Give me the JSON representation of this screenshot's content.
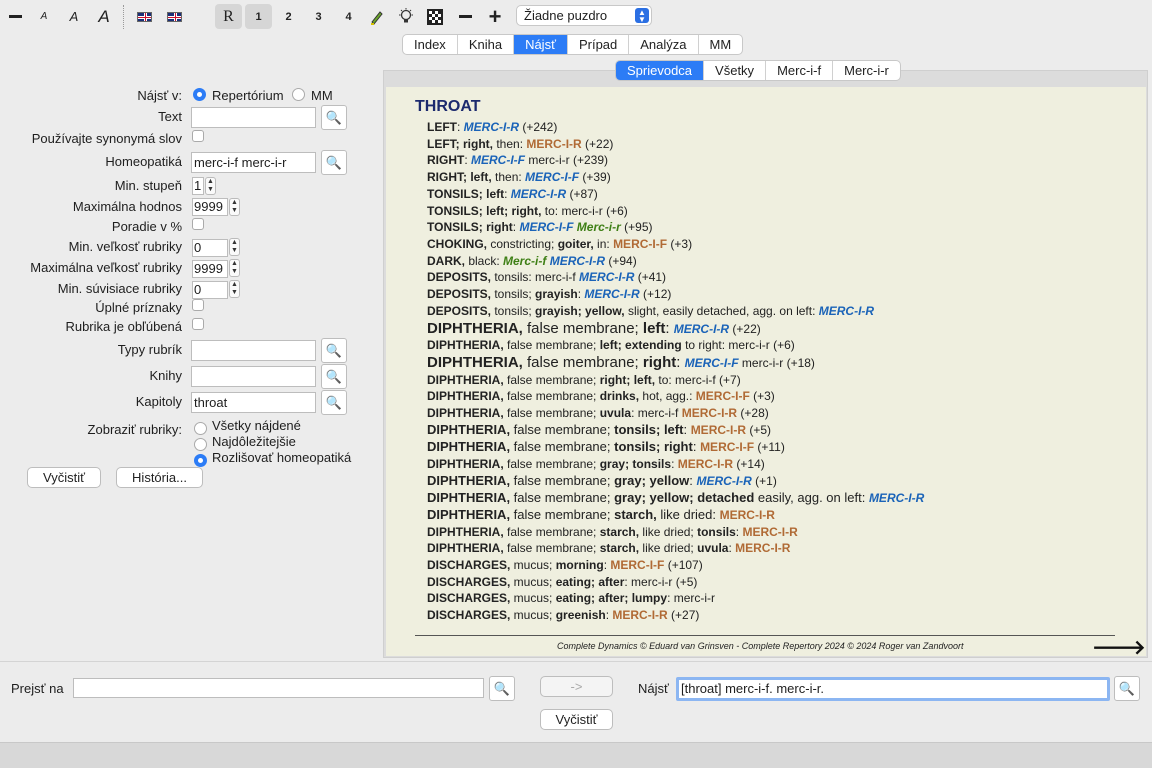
{
  "toolbar": {
    "select_value": "Žiadne puzdro",
    "level_buttons": [
      "R",
      "1",
      "2",
      "3",
      "4"
    ]
  },
  "main_tabs": [
    "Index",
    "Kniha",
    "Nájsť",
    "Prípad",
    "Analýza",
    "MM"
  ],
  "sub_tabs": [
    "Sprievodca",
    "Všetky",
    "Merc-i-f",
    "Merc-i-r"
  ],
  "form": {
    "find_in_label": "Nájsť v:",
    "find_in_options": [
      "Repertórium",
      "MM"
    ],
    "text_label": "Text",
    "text_value": "",
    "synonyms_label": "Používajte synonymá slov",
    "remedy_label": "Homeopatiká",
    "remedy_value": "merc-i-f merc-i-r",
    "min_degree_label": "Min. stupeň",
    "min_degree_value": "1",
    "max_value_label": "Maximálna hodnos",
    "max_value_value": "9999",
    "order_pct_label": "Poradie v %",
    "min_rubric_label": "Min. veľkosť rubriky",
    "min_rubric_value": "0",
    "max_rubric_label": "Maximálna veľkosť rubriky",
    "max_rubric_value": "9999",
    "min_related_label": "Min. súvisiace rubriky",
    "min_related_value": "0",
    "full_symptoms_label": "Úplné príznaky",
    "favorite_label": "Rubrika je obľúbená",
    "rubric_types_label": "Typy rubrík",
    "rubric_types_value": "",
    "books_label": "Knihy",
    "books_value": "",
    "chapters_label": "Kapitoly",
    "chapters_value": "throat",
    "show_label": "Zobraziť rubriky:",
    "show_options": [
      "Všetky nájdené",
      "Najdôležitejšie",
      "Rozlišovať homeopatiká"
    ],
    "clear_button": "Vyčistiť",
    "history_button": "História..."
  },
  "result": {
    "chapter": "THROAT",
    "rubrics": [
      [
        [
          "h",
          "LEFT"
        ],
        [
          "p",
          ": "
        ],
        [
          "b",
          "MERC-I-R"
        ],
        [
          "p",
          " (+242)"
        ]
      ],
      [
        [
          "h",
          "LEFT; right,"
        ],
        [
          "c",
          " then: "
        ],
        [
          "o",
          "MERC-I-R"
        ],
        [
          "p",
          " (+22)"
        ]
      ],
      [
        [
          "h",
          "RIGHT"
        ],
        [
          "p",
          ": "
        ],
        [
          "b",
          "MERC-I-F"
        ],
        [
          "p",
          " merc-i-r (+239)"
        ]
      ],
      [
        [
          "h",
          "RIGHT; left,"
        ],
        [
          "c",
          " then: "
        ],
        [
          "b",
          "MERC-I-F"
        ],
        [
          "p",
          " (+39)"
        ]
      ],
      [
        [
          "h",
          "TONSILS; left"
        ],
        [
          "p",
          ": "
        ],
        [
          "b",
          "MERC-I-R"
        ],
        [
          "p",
          " (+87)"
        ]
      ],
      [
        [
          "h",
          "TONSILS; left; right,"
        ],
        [
          "c",
          " to: merc-i-r (+6)"
        ]
      ],
      [
        [
          "h",
          "TONSILS; right"
        ],
        [
          "p",
          ": "
        ],
        [
          "b",
          "MERC-I-F"
        ],
        [
          "p",
          " "
        ],
        [
          "g",
          "Merc-i-r"
        ],
        [
          "p",
          " (+95)"
        ]
      ],
      [
        [
          "h",
          "CHOKING,"
        ],
        [
          "c",
          " constricting; "
        ],
        [
          "h",
          "goiter,"
        ],
        [
          "c",
          " in: "
        ],
        [
          "o",
          "MERC-I-F"
        ],
        [
          "p",
          " (+3)"
        ]
      ],
      [
        [
          "h",
          "DARK,"
        ],
        [
          "c",
          " black: "
        ],
        [
          "g",
          "Merc-i-f"
        ],
        [
          "p",
          " "
        ],
        [
          "b",
          "MERC-I-R"
        ],
        [
          "p",
          " (+94)"
        ]
      ],
      [
        [
          "h",
          "DEPOSITS,"
        ],
        [
          "c",
          " tonsils: merc-i-f "
        ],
        [
          "b",
          "MERC-I-R"
        ],
        [
          "p",
          " (+41)"
        ]
      ],
      [
        [
          "h",
          "DEPOSITS,"
        ],
        [
          "c",
          " tonsils; "
        ],
        [
          "h",
          "grayish"
        ],
        [
          "p",
          ": "
        ],
        [
          "b",
          "MERC-I-R"
        ],
        [
          "p",
          " (+12)"
        ]
      ],
      [
        [
          "h",
          "DEPOSITS,"
        ],
        [
          "c",
          " tonsils; "
        ],
        [
          "h",
          "grayish; yellow,"
        ],
        [
          "c",
          " slight, easily detached, agg. on left: "
        ],
        [
          "b",
          "MERC-I-R"
        ]
      ],
      [
        [
          "big",
          ""
        ],
        [
          "h",
          "DIPHTHERIA,"
        ],
        [
          "c",
          " false membrane; "
        ],
        [
          "h",
          "left"
        ],
        [
          "p",
          ": "
        ],
        [
          "bs",
          "MERC-I-R"
        ],
        [
          "ps",
          " (+22)"
        ]
      ],
      [
        [
          "h",
          "DIPHTHERIA,"
        ],
        [
          "c",
          " false membrane; "
        ],
        [
          "h",
          "left; extending"
        ],
        [
          "c",
          " to right: merc-i-r (+6)"
        ]
      ],
      [
        [
          "big",
          ""
        ],
        [
          "h",
          "DIPHTHERIA,"
        ],
        [
          "c",
          " false membrane; "
        ],
        [
          "h",
          "right"
        ],
        [
          "p",
          ": "
        ],
        [
          "bs",
          "MERC-I-F"
        ],
        [
          "ps",
          " merc-i-r (+18)"
        ]
      ],
      [
        [
          "h",
          "DIPHTHERIA,"
        ],
        [
          "c",
          " false membrane; "
        ],
        [
          "h",
          "right; left,"
        ],
        [
          "c",
          " to: merc-i-f (+7)"
        ]
      ],
      [
        [
          "h",
          "DIPHTHERIA,"
        ],
        [
          "c",
          " false membrane; "
        ],
        [
          "h",
          "drinks,"
        ],
        [
          "c",
          " hot, agg.: "
        ],
        [
          "o",
          "MERC-I-F"
        ],
        [
          "p",
          " (+3)"
        ]
      ],
      [
        [
          "h",
          "DIPHTHERIA,"
        ],
        [
          "c",
          " false membrane; "
        ],
        [
          "h",
          "uvula"
        ],
        [
          "c",
          ": merc-i-f "
        ],
        [
          "o",
          "MERC-I-R"
        ],
        [
          "p",
          " (+28)"
        ]
      ],
      [
        [
          "mid",
          ""
        ],
        [
          "h",
          "DIPHTHERIA,"
        ],
        [
          "c",
          " false membrane; "
        ],
        [
          "h",
          "tonsils; left"
        ],
        [
          "p",
          ": "
        ],
        [
          "os",
          "MERC-I-R"
        ],
        [
          "ps",
          " (+5)"
        ]
      ],
      [
        [
          "mid",
          ""
        ],
        [
          "h",
          "DIPHTHERIA,"
        ],
        [
          "c",
          " false membrane; "
        ],
        [
          "h",
          "tonsils; right"
        ],
        [
          "p",
          ": "
        ],
        [
          "os",
          "MERC-I-F"
        ],
        [
          "ps",
          " (+11)"
        ]
      ],
      [
        [
          "h",
          "DIPHTHERIA,"
        ],
        [
          "c",
          " false membrane; "
        ],
        [
          "h",
          "gray; tonsils"
        ],
        [
          "p",
          ": "
        ],
        [
          "o",
          "MERC-I-R"
        ],
        [
          "p",
          " (+14)"
        ]
      ],
      [
        [
          "mid",
          ""
        ],
        [
          "h",
          "DIPHTHERIA,"
        ],
        [
          "c",
          " false membrane; "
        ],
        [
          "h",
          "gray; yellow"
        ],
        [
          "p",
          ": "
        ],
        [
          "bs",
          "MERC-I-R"
        ],
        [
          "ps",
          " (+1)"
        ]
      ],
      [
        [
          "mid",
          ""
        ],
        [
          "h",
          "DIPHTHERIA,"
        ],
        [
          "c",
          " false membrane; "
        ],
        [
          "h",
          "gray; yellow; detached"
        ],
        [
          "c",
          " easily, agg. on left: "
        ],
        [
          "bs",
          "MERC-I-R"
        ]
      ],
      [
        [
          "mid",
          ""
        ],
        [
          "h",
          "DIPHTHERIA,"
        ],
        [
          "c",
          " false membrane; "
        ],
        [
          "h",
          "starch,"
        ],
        [
          "c",
          " like dried: "
        ],
        [
          "os",
          "MERC-I-R"
        ]
      ],
      [
        [
          "h",
          "DIPHTHERIA,"
        ],
        [
          "c",
          " false membrane; "
        ],
        [
          "h",
          "starch,"
        ],
        [
          "c",
          " like dried; "
        ],
        [
          "h",
          "tonsils"
        ],
        [
          "p",
          ": "
        ],
        [
          "o",
          "MERC-I-R"
        ]
      ],
      [
        [
          "h",
          "DIPHTHERIA,"
        ],
        [
          "c",
          " false membrane; "
        ],
        [
          "h",
          "starch,"
        ],
        [
          "c",
          " like dried; "
        ],
        [
          "h",
          "uvula"
        ],
        [
          "p",
          ": "
        ],
        [
          "o",
          "MERC-I-R"
        ]
      ],
      [
        [
          "h",
          "DISCHARGES,"
        ],
        [
          "c",
          " mucus; "
        ],
        [
          "h",
          "morning"
        ],
        [
          "p",
          ": "
        ],
        [
          "o",
          "MERC-I-F"
        ],
        [
          "p",
          " (+107)"
        ]
      ],
      [
        [
          "h",
          "DISCHARGES,"
        ],
        [
          "c",
          " mucus; "
        ],
        [
          "h",
          "eating; after"
        ],
        [
          "c",
          ": merc-i-r (+5)"
        ]
      ],
      [
        [
          "h",
          "DISCHARGES,"
        ],
        [
          "c",
          " mucus; "
        ],
        [
          "h",
          "eating; after; lumpy"
        ],
        [
          "c",
          ": merc-i-r"
        ]
      ],
      [
        [
          "h",
          "DISCHARGES,"
        ],
        [
          "c",
          " mucus; "
        ],
        [
          "h",
          "greenish"
        ],
        [
          "p",
          ": "
        ],
        [
          "o",
          "MERC-I-R"
        ],
        [
          "p",
          " (+27)"
        ]
      ]
    ],
    "copyright": "Complete Dynamics © Eduard van Grinsven   -   Complete Repertory 2024 © 2024 Roger van Zandvoort"
  },
  "bottom": {
    "goto_label": "Prejsť na",
    "goto_value": "",
    "arrow_button": "->",
    "find_label": "Nájsť",
    "find_value": "[throat] merc-i-f. merc-i-r.",
    "clear_button": "Vyčistiť"
  },
  "colors": {
    "accent": "#2c7cf6",
    "bold_remedy": "#1a63b8",
    "mid_remedy": "#b06a35",
    "green_remedy": "#3e7f15",
    "content_bg": "#efefdf"
  }
}
